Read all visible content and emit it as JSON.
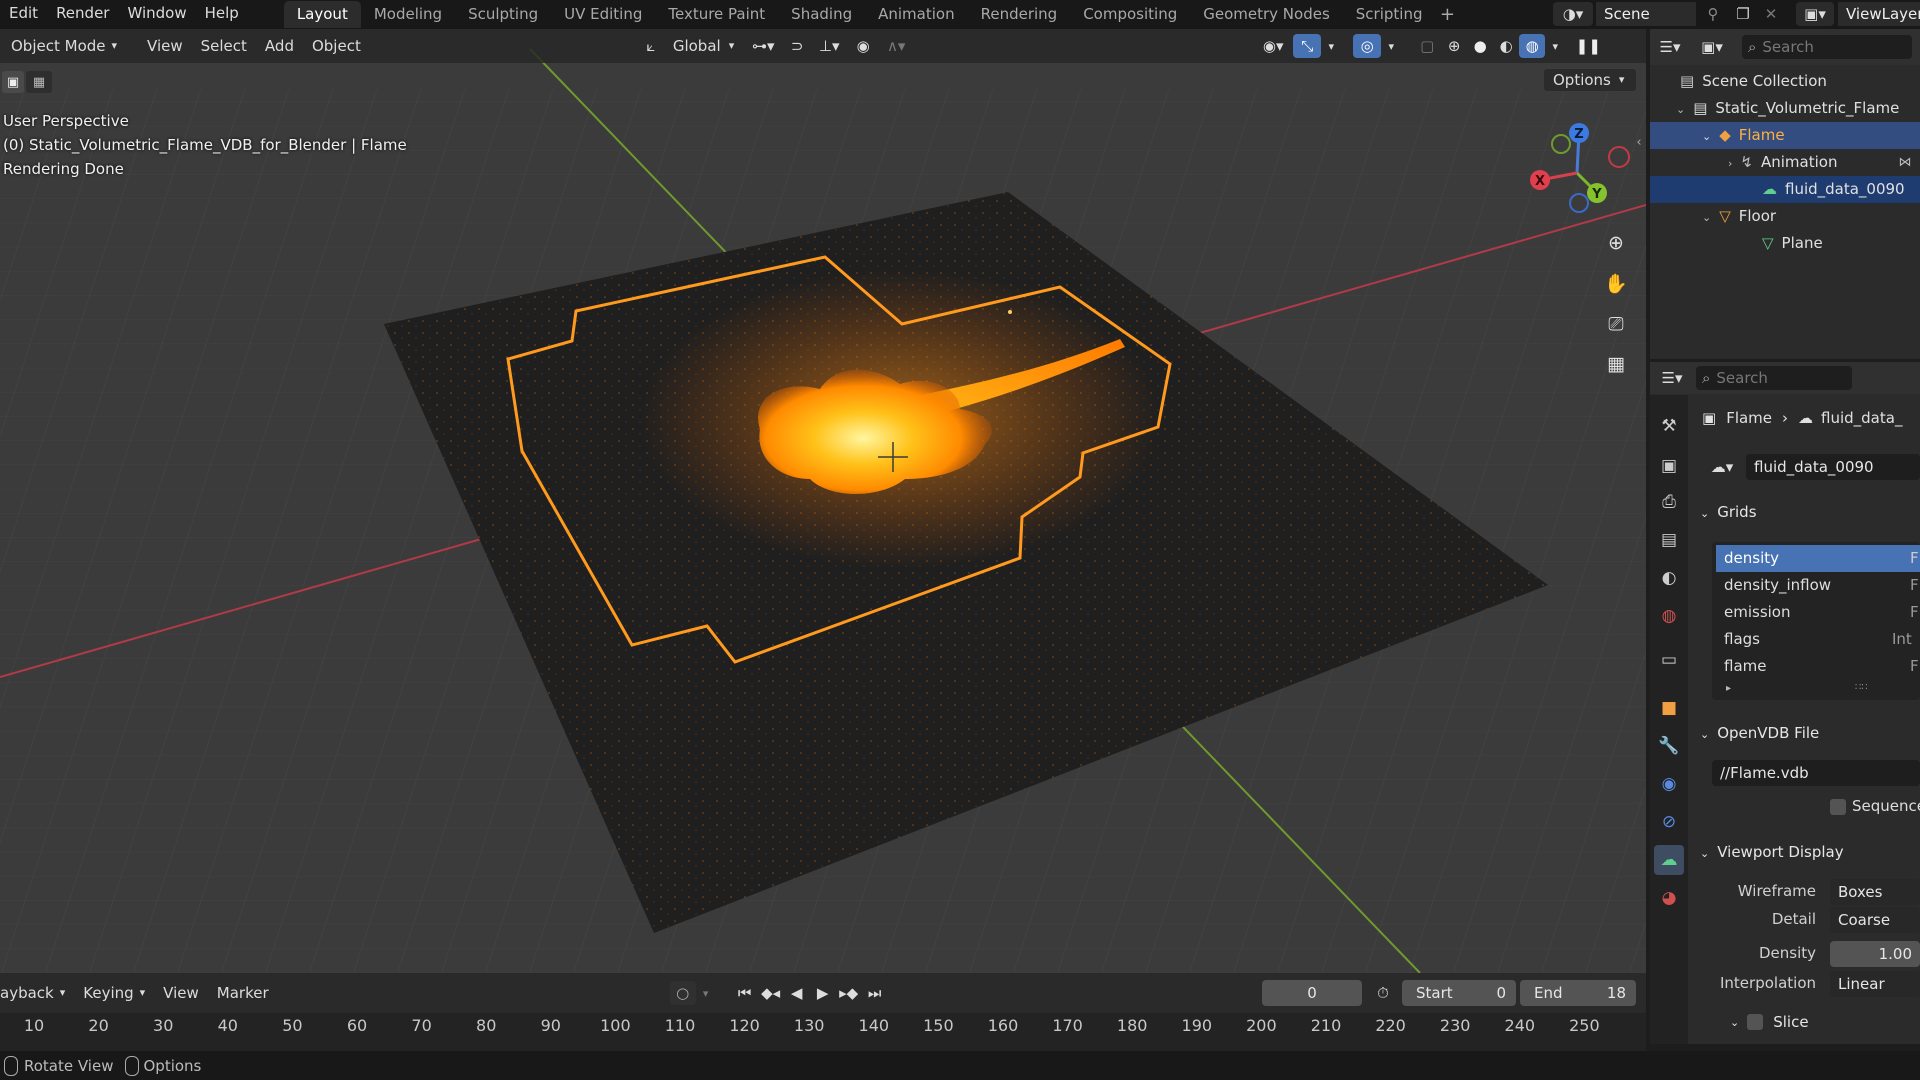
{
  "topbar": {
    "menus": [
      "Edit",
      "Render",
      "Window",
      "Help"
    ],
    "workspaces": [
      "Layout",
      "Modeling",
      "Sculpting",
      "UV Editing",
      "Texture Paint",
      "Shading",
      "Animation",
      "Rendering",
      "Compositing",
      "Geometry Nodes",
      "Scripting"
    ],
    "active_workspace": "Layout",
    "scene_label": "Scene",
    "viewlayer_label": "ViewLayer"
  },
  "viewport_header": {
    "mode": "Object Mode",
    "menus": [
      "View",
      "Select",
      "Add",
      "Object"
    ],
    "transform_orientation": "Global",
    "options_label": "Options"
  },
  "viewport": {
    "view_name": "User Perspective",
    "object_info": "(0) Static_Volumetric_Flame_VDB_for_Blender | Flame",
    "status": "Rendering Done",
    "gizmo_axes": {
      "x": "X",
      "y": "Y",
      "z": "Z"
    },
    "colors": {
      "selection_outline": "#ff9a1f",
      "x_axis": "#b23a48",
      "y_axis": "#6e9a2e",
      "flame_core": "#ffd84a"
    }
  },
  "outliner": {
    "search_placeholder": "Search",
    "rows": [
      {
        "label": "Scene Collection"
      },
      {
        "label": "Static_Volumetric_Flame"
      },
      {
        "label": "Flame"
      },
      {
        "label": "Animation"
      },
      {
        "label": "fluid_data_0090"
      },
      {
        "label": "Floor"
      },
      {
        "label": "Plane"
      }
    ]
  },
  "properties": {
    "search_placeholder": "Search",
    "breadcrumb": {
      "object": "Flame",
      "data": "fluid_data_"
    },
    "datablock_name": "fluid_data_0090",
    "grids_header": "Grids",
    "grids": [
      {
        "name": "density",
        "type": "F"
      },
      {
        "name": "density_inflow",
        "type": "F"
      },
      {
        "name": "emission",
        "type": "F"
      },
      {
        "name": "flags",
        "type": "Int"
      },
      {
        "name": "flame",
        "type": "F"
      }
    ],
    "openvdb_header": "OpenVDB File",
    "filepath": "//Flame.vdb",
    "sequence_label": "Sequence",
    "viewport_display_header": "Viewport Display",
    "wireframe_label": "Wireframe",
    "wireframe_value": "Boxes",
    "detail_label": "Detail",
    "detail_value": "Coarse",
    "density_label": "Density",
    "density_value": "1.00",
    "interpolation_label": "Interpolation",
    "interpolation_value": "Linear",
    "slice_label": "Slice"
  },
  "timeline": {
    "menus": [
      "ayback",
      "Keying",
      "View",
      "Marker"
    ],
    "current_frame": "0",
    "start_label": "Start",
    "start_value": "0",
    "end_label": "End",
    "end_value": "18",
    "ticks": [
      "10",
      "20",
      "30",
      "40",
      "50",
      "60",
      "70",
      "80",
      "90",
      "100",
      "110",
      "120",
      "130",
      "140",
      "150",
      "160",
      "170",
      "180",
      "190",
      "200",
      "210",
      "220",
      "230",
      "240",
      "250"
    ]
  },
  "statusbar": {
    "hint1": "Rotate View",
    "hint2": "Options"
  }
}
